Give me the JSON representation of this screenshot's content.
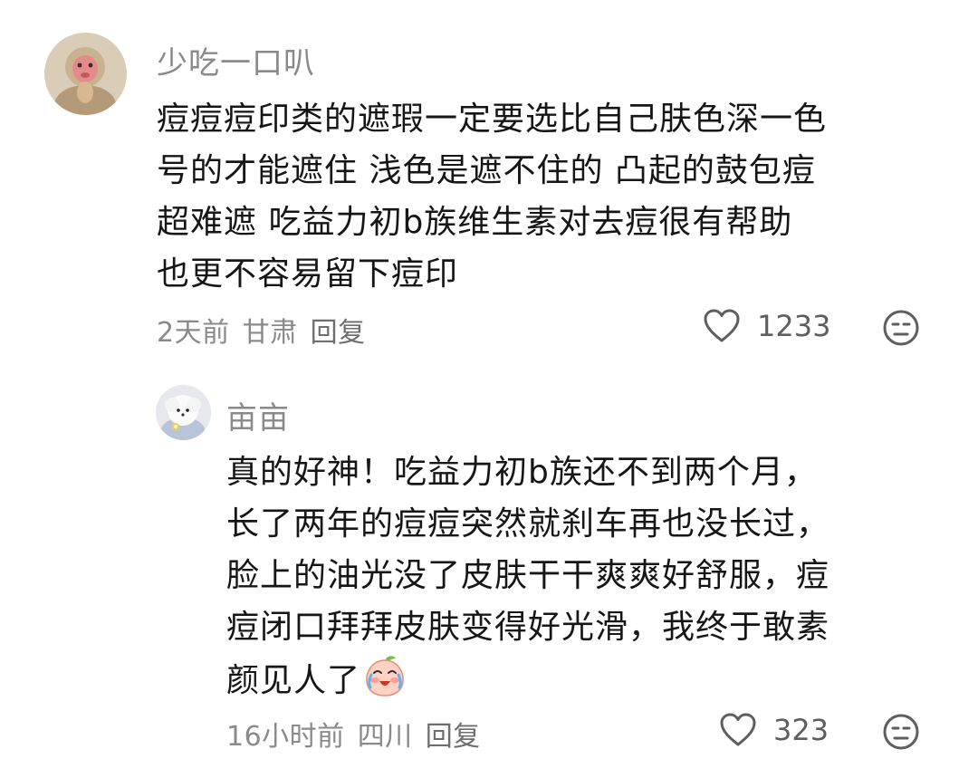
{
  "comment1": {
    "username": "少吃一口叭",
    "lines": [
      "痘痘痘印类的遮瑕一定要选比自己肤色深一色",
      "号的才能遮住 浅色是遮不住的 凸起的鼓包痘",
      "超难遮 吃益力初b族维生素对去痘很有帮助",
      "也更不容易留下痘印"
    ],
    "time": "2天前",
    "location": "甘肃",
    "reply_label": "回复",
    "like_count": "1233",
    "avatar_icon": "monkey-avatar"
  },
  "reply1": {
    "username": "亩亩",
    "lines": [
      "真的好神！吃益力初b族还不到两个月，",
      "长了两年的痘痘突然就刹车再也没长过，",
      "脸上的油光没了皮肤干干爽爽好舒服，痘",
      "痘闭口拜拜皮肤变得好光滑，我终于敢素",
      "颜见人了"
    ],
    "emoji": "crying-laughing-peach-emoji",
    "time": "16小时前",
    "location": "四川",
    "reply_label": "回复",
    "like_count": "323",
    "avatar_icon": "white-puppy-avatar"
  },
  "icons": {
    "like": "heart-outline-icon",
    "dislike": "meh-face-icon"
  },
  "colors": {
    "text": "#161616",
    "meta": "#8a8a8a",
    "icon": "#5e5e5e"
  }
}
